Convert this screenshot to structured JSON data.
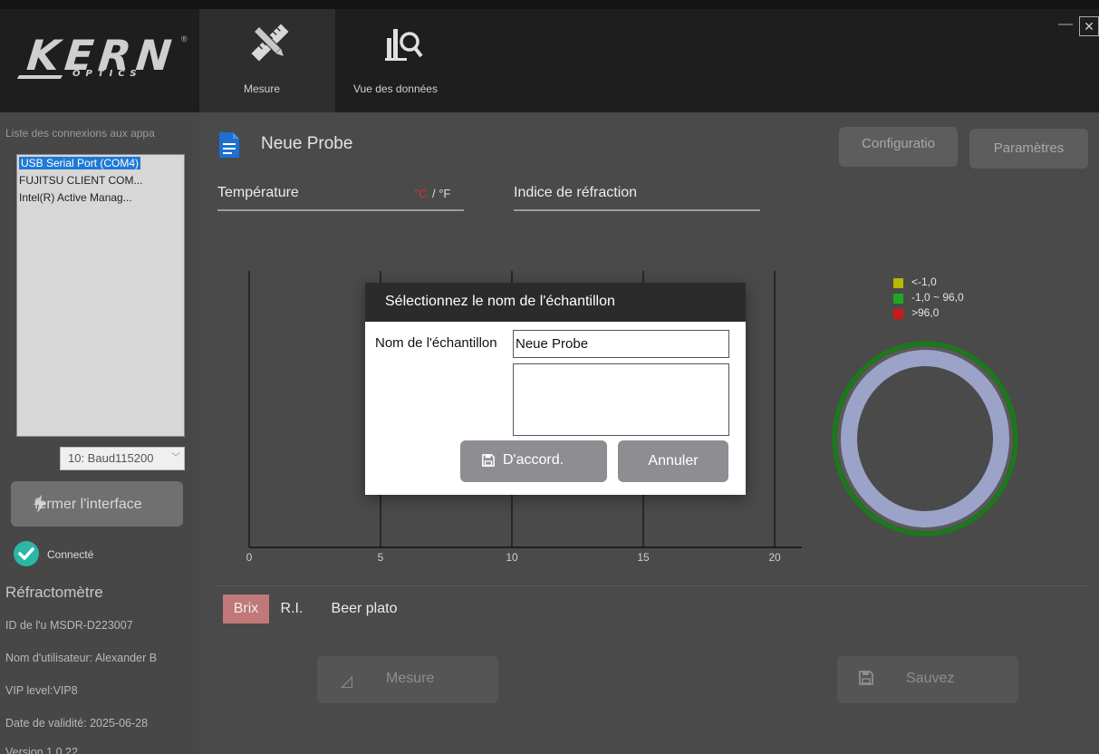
{
  "window": {
    "minimize_glyph": "—",
    "close_glyph": "✕"
  },
  "logo": {
    "word": "KERN",
    "sub": "OPTICS",
    "reg": "®"
  },
  "tabs": [
    {
      "label": "Mesure",
      "icon": "ruler-pencil-icon",
      "active": true
    },
    {
      "label": "Vue des données",
      "icon": "chart-magnifier-icon",
      "active": false
    }
  ],
  "sidebar": {
    "connections_title": "Liste des connexions aux appa",
    "devices": [
      {
        "label": "USB Serial Port (COM4)",
        "selected": true
      },
      {
        "label": "FUJITSU CLIENT COM...",
        "selected": false
      },
      {
        "label": "Intel(R) Active Manag...",
        "selected": false
      }
    ],
    "baud_rate": "10: Baud115200",
    "close_interface_label": "fermer l'interface",
    "status_text": "Connecté",
    "device_type": "Réfractomètre",
    "device_id": "ID de l'u MSDR-D223007",
    "user_name": "Nom d'utilisateur: Alexander B",
    "vip_level": "VIP level:VIP8",
    "validity_date": "Date de validité: 2025-06-28",
    "version": "Version 1.0.22"
  },
  "main": {
    "sample_name": "Neue Probe",
    "config_button": "Configuratio",
    "params_button": "Paramètres",
    "temperature_label": "Température",
    "temp_unit_c": "°C",
    "temp_unit_sep_f": "/ °F",
    "refraction_label": "Indice de réfraction",
    "unit_tabs": [
      "Brix",
      "R.I.",
      "Beer plato"
    ],
    "measure_button": "Mesure",
    "save_button": "Sauvez"
  },
  "colors": {
    "legend_low": "#b8b800",
    "legend_mid": "#1fa81f",
    "legend_high": "#d01818",
    "ring_green": "#1a7a1a",
    "ring_gray": "#9ba4c8",
    "active_unit_tab": "#c07878",
    "celsius": "#e03030"
  },
  "chart_data": {
    "type": "line",
    "x_ticks": [
      "0",
      "5",
      "10",
      "15",
      "20"
    ],
    "xlim": [
      0,
      20
    ],
    "series": [],
    "legend": [
      {
        "label": "<-1,0",
        "color": "#b8b800"
      },
      {
        "label": "-1,0 ~ 96,0",
        "color": "#1fa81f"
      },
      {
        "label": ">96,0",
        "color": "#d01818"
      }
    ]
  },
  "dialog": {
    "title": "Sélectionnez le nom de l'échantillon",
    "name_label": "Nom de l'échantillon",
    "name_value": "Neue Probe",
    "note_value": "",
    "ok_label": "D'accord.",
    "cancel_label": "Annuler"
  }
}
